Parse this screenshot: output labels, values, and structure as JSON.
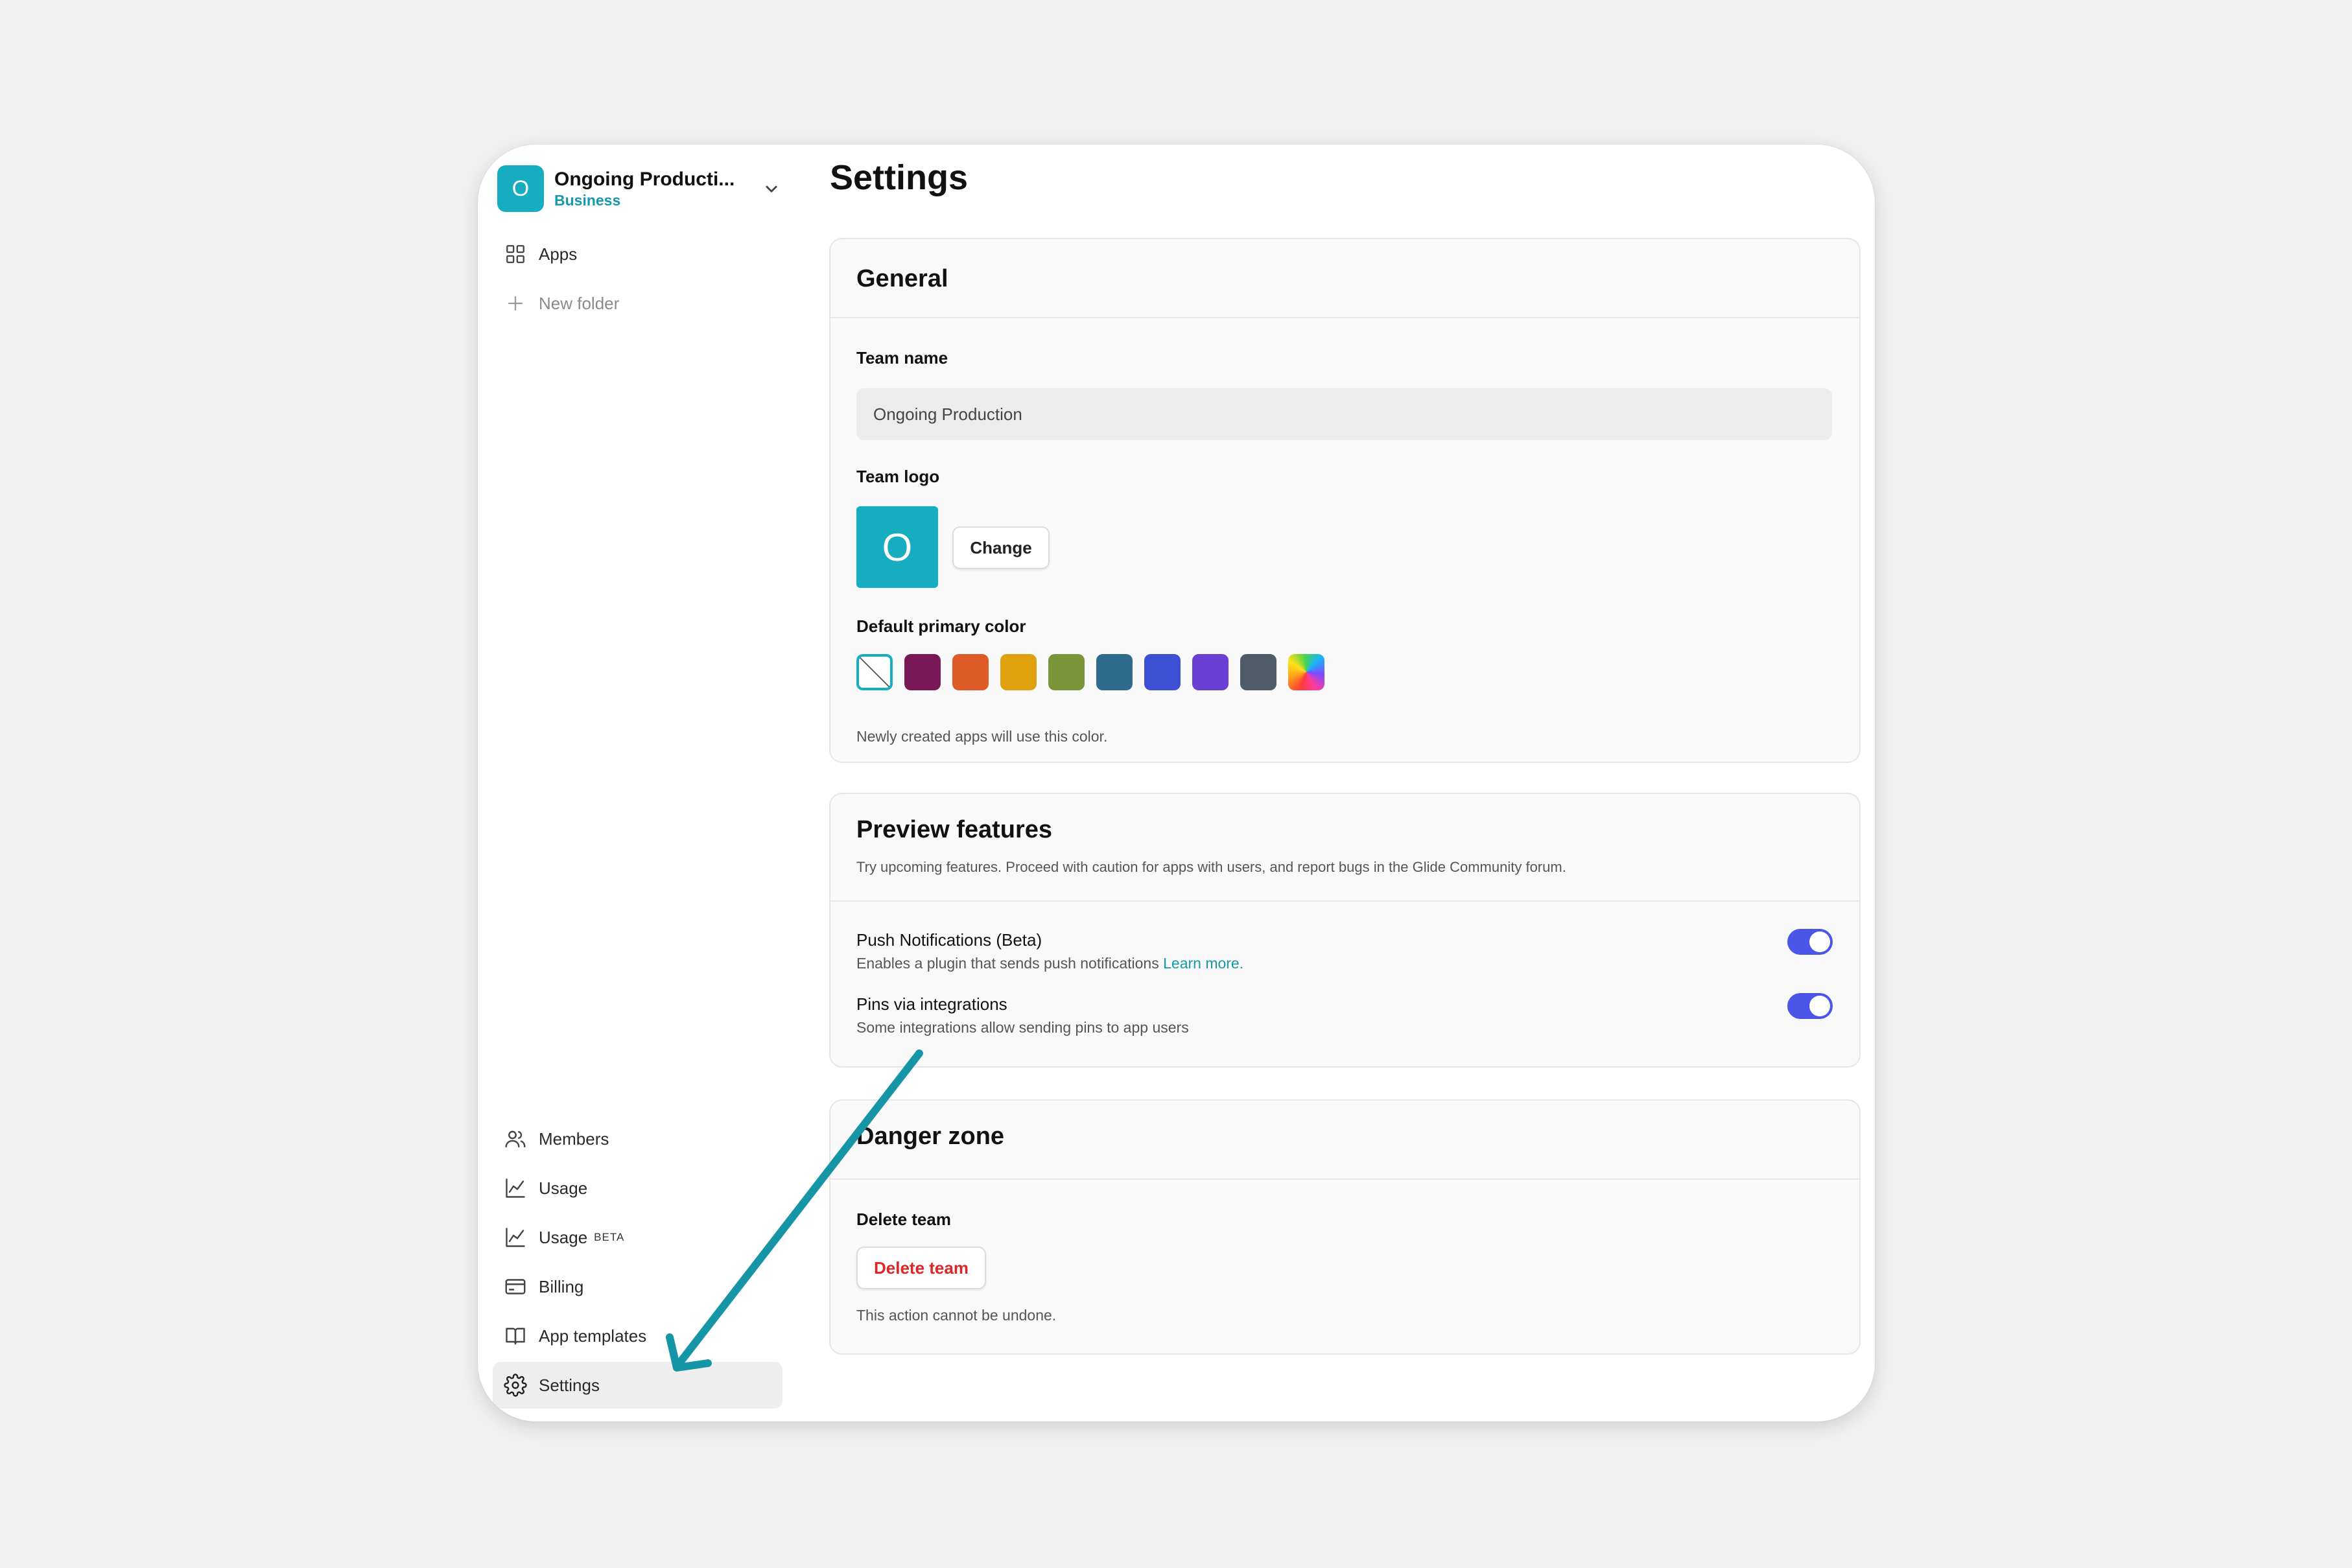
{
  "team": {
    "avatar_letter": "O",
    "name": "Ongoing Producti...",
    "plan": "Business"
  },
  "sidebar": {
    "top_items": [
      {
        "label": "Apps",
        "icon": "grid-icon"
      },
      {
        "label": "New folder",
        "icon": "plus-icon"
      }
    ],
    "bottom_items": [
      {
        "label": "Members",
        "icon": "users-icon"
      },
      {
        "label": "Usage",
        "icon": "chart-line-icon"
      },
      {
        "label": "Usage",
        "badge": "BETA",
        "icon": "chart-line-icon"
      },
      {
        "label": "Billing",
        "icon": "credit-card-icon"
      },
      {
        "label": "App templates",
        "icon": "book-icon"
      },
      {
        "label": "Settings",
        "icon": "gear-icon",
        "active": true
      }
    ]
  },
  "page": {
    "title": "Settings"
  },
  "general": {
    "heading": "General",
    "team_name_label": "Team name",
    "team_name_value": "Ongoing Production",
    "team_logo_label": "Team logo",
    "logo_letter": "O",
    "change_button": "Change",
    "color_label": "Default primary color",
    "colors": [
      "none",
      "#7a1857",
      "#de5a26",
      "#dfa10d",
      "#7a9439",
      "#2f6b8c",
      "#3d4fd3",
      "#6b3fd3",
      "#4d5c68",
      "rainbow"
    ],
    "selected_color": "none",
    "color_hint": "Newly created apps will use this color."
  },
  "preview": {
    "heading": "Preview features",
    "description": "Try upcoming features. Proceed with caution for apps with users, and report bugs in the Glide Community forum.",
    "features": [
      {
        "title": "Push Notifications (Beta)",
        "desc": "Enables a plugin that sends push notifications ",
        "link": "Learn more.",
        "enabled": true
      },
      {
        "title": "Pins via integrations",
        "desc": "Some integrations allow sending pins to app users",
        "enabled": true
      }
    ]
  },
  "danger": {
    "heading": "Danger zone",
    "delete_label": "Delete team",
    "delete_button": "Delete team",
    "hint": "This action cannot be undone."
  },
  "annotation": {
    "arrow_color": "#1595a5"
  },
  "colors": {
    "accent": "#17adc1",
    "toggle": "#4b55e8",
    "danger": "#de2626",
    "link": "#1798a9"
  }
}
